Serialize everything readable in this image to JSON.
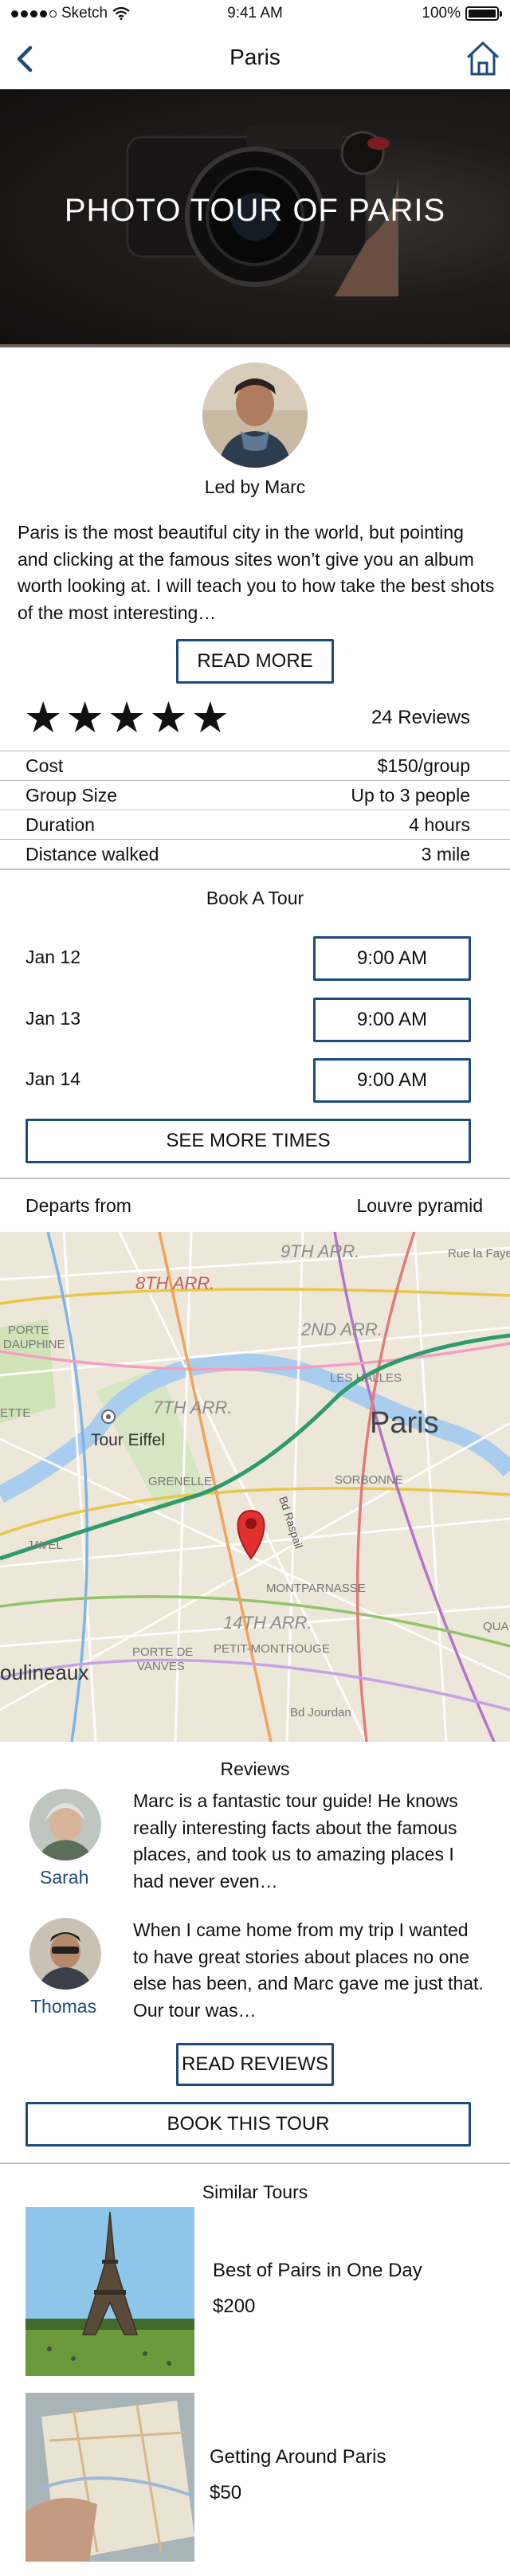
{
  "status_bar": {
    "carrier": "Sketch",
    "time": "9:41 AM",
    "battery": "100%"
  },
  "nav": {
    "title": "Paris"
  },
  "hero": {
    "headline": "PHOTO TOUR OF PARIS"
  },
  "guide": {
    "led_by": "Led by Marc",
    "description": "Paris is the most beautiful city in the world, but pointing and clicking at the famous sites won’t give you an album worth looking at. I will teach you to how take the best shots of the most interesting…",
    "read_more_label": "READ MORE"
  },
  "rating": {
    "stars": "★★★★★",
    "value": 5,
    "reviews_count": "24 Reviews"
  },
  "details": [
    {
      "key": "Cost",
      "value": "$150/group"
    },
    {
      "key": "Group Size",
      "value": "Up to 3 people"
    },
    {
      "key": "Duration",
      "value": "4 hours"
    },
    {
      "key": "Distance walked",
      "value": "3 mile"
    }
  ],
  "booking": {
    "title": "Book A Tour",
    "slots": [
      {
        "date": "Jan 12",
        "time": "9:00 AM"
      },
      {
        "date": "Jan 13",
        "time": "9:00 AM"
      },
      {
        "date": "Jan 14",
        "time": "9:00 AM"
      }
    ],
    "see_more_label": "SEE MORE TIMES"
  },
  "departs": {
    "label": "Departs from",
    "value": "Louvre pyramid"
  },
  "map": {
    "labels": {
      "ar9": "9TH ARR.",
      "ar8": "8TH ARR.",
      "ar2": "2ND ARR.",
      "halles": "LES HALLES",
      "porte_dauphine": "PORTE\nDAUPHINE",
      "ar7": "7TH ARR.",
      "paris": "Paris",
      "tour_eiffel": "Tour Eiffel",
      "grenelle": "GRENELLE",
      "sorbonne": "SORBONNE",
      "ette": "ETTE",
      "javel": "JAVEL",
      "montparnasse": "MONTPARNASSE",
      "ar14": "14TH ARR.",
      "petit_montrouge": "PETIT-MONTROUGE",
      "porte_vanves": "PORTE DE\nVANVES",
      "moulineaux": "oulineaux",
      "bd_jourdan": "Bd Jourdan",
      "bd_raspail": "Bd Raspail",
      "rue_fayette": "Rue la Fayette",
      "qua": "QUA"
    }
  },
  "reviews": {
    "title": "Reviews",
    "items": [
      {
        "name": "Sarah",
        "text": "Marc is a fantastic tour guide! He knows really interesting facts about the famous places, and took us to amazing places I had never even…"
      },
      {
        "name": "Thomas",
        "text": "When I came home from my trip I wanted to have great stories about places no one else has been, and Marc gave me just that. Our tour was…"
      }
    ],
    "read_reviews_label": "READ REVIEWS"
  },
  "book_this_label": "BOOK THIS TOUR",
  "similar": {
    "title": "Similar Tours",
    "items": [
      {
        "name": "Best of Pairs in One Day",
        "price": "$200"
      },
      {
        "name": "Getting Around Paris",
        "price": "$50"
      }
    ]
  },
  "colors": {
    "accent": "#1c4b7d",
    "rule": "#bfbfbf",
    "map_pin": "#e3302f"
  },
  "icons": {
    "back": "chevron-left-icon",
    "home": "home-icon",
    "wifi": "wifi-icon",
    "battery": "battery-icon"
  }
}
